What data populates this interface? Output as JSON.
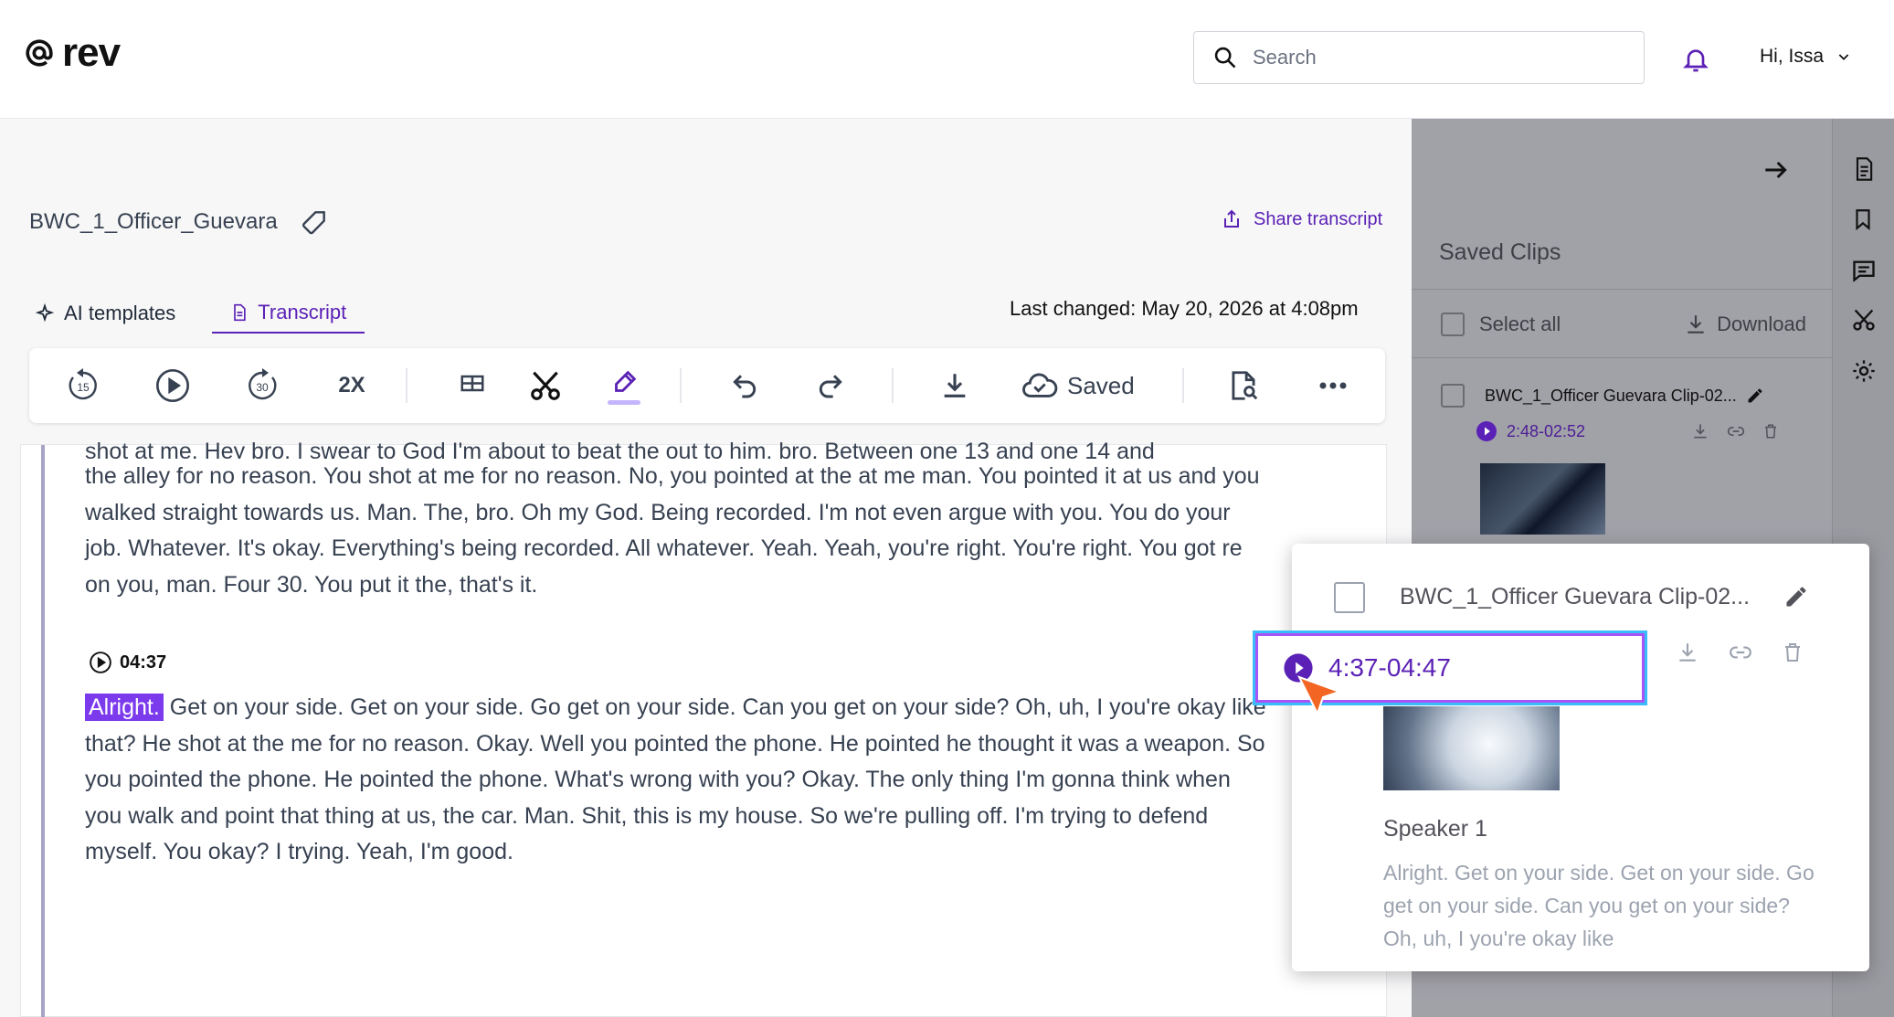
{
  "header": {
    "brand": "rev",
    "search_placeholder": "Search",
    "user_greeting": "Hi, Issa"
  },
  "document": {
    "title": "BWC_1_Officer_Guevara",
    "share_label": "Share transcript",
    "last_changed": "Last changed: May 20, 2026 at 4:08pm"
  },
  "tabs": [
    {
      "label": "AI templates",
      "active": false
    },
    {
      "label": "Transcript",
      "active": true
    }
  ],
  "toolbar": {
    "rewind_label": "15",
    "forward_label": "30",
    "speed_label": "2X",
    "saved_label": "Saved"
  },
  "transcript": {
    "para1_cut": "shot at me. Hey bro. I swear to God I'm about to beat the out to him, bro. Between one 13 and one 14 and",
    "para1": "the alley for no reason. You shot at me for no reason. No, you pointed at the at me man. You pointed it at us and you walked straight towards us. Man. The, bro. Oh my God. Being recorded. I'm not even argue with you. You do your job. Whatever. It's okay. Everything's being recorded. All whatever. Yeah. Yeah, you're right. You're right. You got re on you, man. Four 30. You put it the, that's it.",
    "timestamp": "04:37",
    "para2_highlight": "Alright.",
    "para2": " Get on your side. Get on your side. Go get on your side. Can you get on your side? Oh, uh, I you're okay like that? He shot at the me for no reason. Okay. Well you pointed the phone. He pointed he thought it was a weapon. So you pointed the phone. He pointed the phone. What's wrong with you? Okay. The only thing I'm gonna think when you walk and point that thing at us, the car. Man. Shit, this is my house. So we're pulling off. I'm trying to defend myself. You okay? I trying. Yeah, I'm good."
  },
  "saved_clips": {
    "title": "Saved Clips",
    "select_all": "Select all",
    "download": "Download",
    "clips": [
      {
        "name": "BWC_1_Officer Guevara Clip-02...",
        "time": "2:48-02:52"
      }
    ]
  },
  "clip_card": {
    "name": "BWC_1_Officer Guevara Clip-02...",
    "time": "4:37-04:47",
    "speaker": "Speaker 1",
    "snippet": "Alright. Get on your side. Get on your side. Go get on your side. Can you get on your side? Oh, uh, I you're okay like"
  },
  "colors": {
    "accent": "#5b21b6",
    "highlight": "#7c3aed",
    "focus_ring": "#38bdf8",
    "cursor": "#f26522"
  }
}
